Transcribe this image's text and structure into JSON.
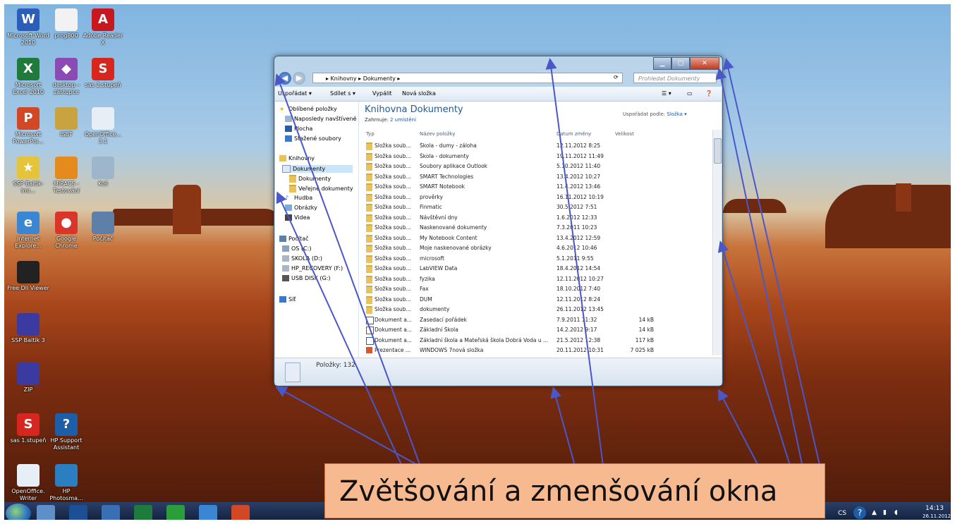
{
  "caption": "Zvětšování a zmenšování okna",
  "desktop_icons": [
    {
      "label": "Microsoft Word 2010",
      "icon": "word-icon",
      "color": "#2b5eb8",
      "glyph": "W"
    },
    {
      "label": "prog800",
      "icon": "blank-file-icon",
      "color": "#f2f2f2",
      "glyph": ""
    },
    {
      "label": "Adobe Reader X",
      "icon": "adobe-reader-icon",
      "color": "#c8171e",
      "glyph": "A"
    },
    {
      "label": "Microsoft Excel 2010",
      "icon": "excel-icon",
      "color": "#1f7b3c",
      "glyph": "X"
    },
    {
      "label": "desktop – zástupce",
      "icon": "desktop-shortcut-icon",
      "color": "#8a4bb5",
      "glyph": "◆"
    },
    {
      "label": "sas 2.stupeň",
      "icon": "sas-icon",
      "color": "#d7261d",
      "glyph": "S"
    },
    {
      "label": "Microsoft PowerPoi...",
      "icon": "powerpoint-icon",
      "color": "#d24726",
      "glyph": "P"
    },
    {
      "label": "ISBT",
      "icon": "folder-icon",
      "color": "#c9a33f",
      "glyph": ""
    },
    {
      "label": "OpenOffice... 3.1",
      "icon": "openoffice-icon",
      "color": "#e8eef6",
      "glyph": ""
    },
    {
      "label": "SSP Baltík-Imi...",
      "icon": "baltik-icon",
      "color": "#e5c33a",
      "glyph": "★"
    },
    {
      "label": "MIRACS - Testování",
      "icon": "miracs-icon",
      "color": "#e58a1c",
      "glyph": ""
    },
    {
      "label": "Koš",
      "icon": "recycle-bin-icon",
      "color": "#9db6cc",
      "glyph": ""
    },
    {
      "label": "Internet Explore...",
      "icon": "internet-explorer-icon",
      "color": "#3a86d2",
      "glyph": "e"
    },
    {
      "label": "Google Chrome",
      "icon": "chrome-icon",
      "color": "#d9352a",
      "glyph": "●"
    },
    {
      "label": "Počítač",
      "icon": "computer-icon",
      "color": "#5e7fa8",
      "glyph": ""
    },
    {
      "label": "Free Dll Viewer",
      "icon": "dll-viewer-icon",
      "color": "#222222",
      "glyph": ""
    },
    {
      "label": "SSP Baltík 3",
      "icon": "baltik-wizard-icon",
      "color": "#3a3aa0",
      "glyph": ""
    },
    {
      "label": "ZIP",
      "icon": "zip-icon",
      "color": "#3a3aa0",
      "glyph": ""
    },
    {
      "label": "sas 1.stupeň",
      "icon": "sas-icon",
      "color": "#d7261d",
      "glyph": "S"
    },
    {
      "label": "HP Support Assistant",
      "icon": "help-icon",
      "color": "#1d5ea8",
      "glyph": "?"
    },
    {
      "label": "OpenOffice. Writer",
      "icon": "writer-icon",
      "color": "#e6eef6",
      "glyph": ""
    },
    {
      "label": "HP Photosma...",
      "icon": "hp-photosmart-icon",
      "color": "#2b7fc1",
      "glyph": ""
    }
  ],
  "window": {
    "breadcrumb": "▸ Knihovny ▸ Dokumenty ▸",
    "search_placeholder": "Prohledat Dokumenty",
    "toolbar": {
      "organize": "Uspořádat ▾",
      "share": "Sdílet s ▾",
      "burn": "Vypálit",
      "new_folder": "Nová složka"
    },
    "nav": {
      "favorites": "Oblíbené položky",
      "recent": "Naposledy navštívené",
      "desktop": "Plocha",
      "downloads": "Stažené soubory",
      "libraries": "Knihovny",
      "documents": "Dokumenty",
      "my_documents": "Dokumenty",
      "public_documents": "Veřejné dokumenty",
      "music": "Hudba",
      "pictures": "Obrázky",
      "videos": "Videa",
      "computer": "Počítač",
      "drive_c": "OS (C:)",
      "drive_d": "SKOLA (D:)",
      "drive_f": "HP_RECOVERY (F:)",
      "drive_g": "USB DISK (G:)",
      "network": "Síť"
    },
    "library_title": "Knihovna Dokumenty",
    "library_includes_label": "Zahrnuje:",
    "library_includes_value": "2 umístění",
    "arrange_label": "Uspořádat podle:",
    "arrange_value": "Složka ▾",
    "columns": {
      "type": "Typ",
      "name": "Název položky",
      "date": "Datum změny",
      "size": "Velikost"
    },
    "rows": [
      {
        "kind": "folder",
        "type": "Složka soub...",
        "name": "Škola - dumy - záloha",
        "date": "12.11.2012 8:25",
        "size": ""
      },
      {
        "kind": "folder",
        "type": "Složka soub...",
        "name": "Škola - dokumenty",
        "date": "19.11.2012 11:49",
        "size": ""
      },
      {
        "kind": "folder",
        "type": "Složka soub...",
        "name": "Soubory aplikace Outlook",
        "date": "5.10.2012 11:40",
        "size": ""
      },
      {
        "kind": "folder",
        "type": "Složka soub...",
        "name": "SMART Technologies",
        "date": "13.4.2012 10:27",
        "size": ""
      },
      {
        "kind": "folder",
        "type": "Složka soub...",
        "name": "SMART Notebook",
        "date": "11.4.2012 13:46",
        "size": ""
      },
      {
        "kind": "folder",
        "type": "Složka soub...",
        "name": "prověrky",
        "date": "16.11.2012 10:19",
        "size": ""
      },
      {
        "kind": "folder",
        "type": "Složka soub...",
        "name": "Finmatic",
        "date": "30.5.2012 7:51",
        "size": ""
      },
      {
        "kind": "folder",
        "type": "Složka soub...",
        "name": "Návštěvní dny",
        "date": "1.6.2012 12:33",
        "size": ""
      },
      {
        "kind": "folder",
        "type": "Složka soub...",
        "name": "Naskenované dokumenty",
        "date": "7.3.2011 10:23",
        "size": ""
      },
      {
        "kind": "folder",
        "type": "Složka soub...",
        "name": "My Notebook Content",
        "date": "13.4.2012 12:59",
        "size": ""
      },
      {
        "kind": "folder",
        "type": "Složka soub...",
        "name": "Moje naskenované obrázky",
        "date": "4.6.2012 10:46",
        "size": ""
      },
      {
        "kind": "folder",
        "type": "Složka soub...",
        "name": "microsoft",
        "date": "5.1.2011 9:55",
        "size": ""
      },
      {
        "kind": "folder",
        "type": "Složka soub...",
        "name": "LabVIEW Data",
        "date": "18.4.2012 14:54",
        "size": ""
      },
      {
        "kind": "folder",
        "type": "Složka soub...",
        "name": "fyzika",
        "date": "12.11.2012 10:27",
        "size": ""
      },
      {
        "kind": "folder",
        "type": "Složka soub...",
        "name": "Fax",
        "date": "18.10.2012 7:40",
        "size": ""
      },
      {
        "kind": "folder",
        "type": "Složka soub...",
        "name": "DUM",
        "date": "12.11.2012 8:24",
        "size": ""
      },
      {
        "kind": "folder",
        "type": "Složka soub...",
        "name": "dokumenty",
        "date": "26.11.2012 13:45",
        "size": ""
      },
      {
        "kind": "doc",
        "type": "Dokument a...",
        "name": "Zasedací pořádek",
        "date": "7.9.2011 11:32",
        "size": "14 kB"
      },
      {
        "kind": "doc",
        "type": "Dokument a...",
        "name": "Základní Škola",
        "date": "14.2.2012 9:17",
        "size": "14 kB"
      },
      {
        "kind": "doc",
        "type": "Dokument a...",
        "name": "Základní škola a Mateřská škola Dobrá Voda u ...",
        "date": "21.5.2012 12:38",
        "size": "117 kB"
      },
      {
        "kind": "ppt",
        "type": "Prezentace ...",
        "name": "WINDOWS 7nová složka",
        "date": "20.11.2012 10:31",
        "size": "7 025 kB"
      }
    ],
    "details_text": "Položky: 132"
  },
  "taskbar": {
    "items": [
      {
        "icon": "start-orb-icon"
      },
      {
        "icon": "explorer-icon"
      },
      {
        "icon": "media-player-icon"
      },
      {
        "icon": "hp-icon"
      },
      {
        "icon": "excel-icon"
      },
      {
        "icon": "chrome-icon"
      },
      {
        "icon": "internet-explorer-icon"
      },
      {
        "icon": "powerpoint-icon"
      }
    ],
    "language": "CS",
    "time": "14:13",
    "date": "26.11.2012"
  }
}
